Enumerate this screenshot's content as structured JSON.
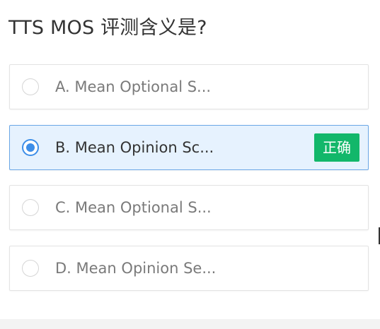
{
  "question": {
    "title": "TTS MOS 评测含义是?"
  },
  "options": [
    {
      "text": "A. Mean Optional S...",
      "selected": false
    },
    {
      "text": "B. Mean Opinion Sc...",
      "selected": true,
      "badge": "正确"
    },
    {
      "text": "C. Mean Optional S...",
      "selected": false
    },
    {
      "text": "D. Mean Opinion Se...",
      "selected": false
    }
  ],
  "colors": {
    "accent": "#3d8ee8",
    "selected_bg": "#e6f2fe",
    "correct_badge": "#12b76a"
  }
}
